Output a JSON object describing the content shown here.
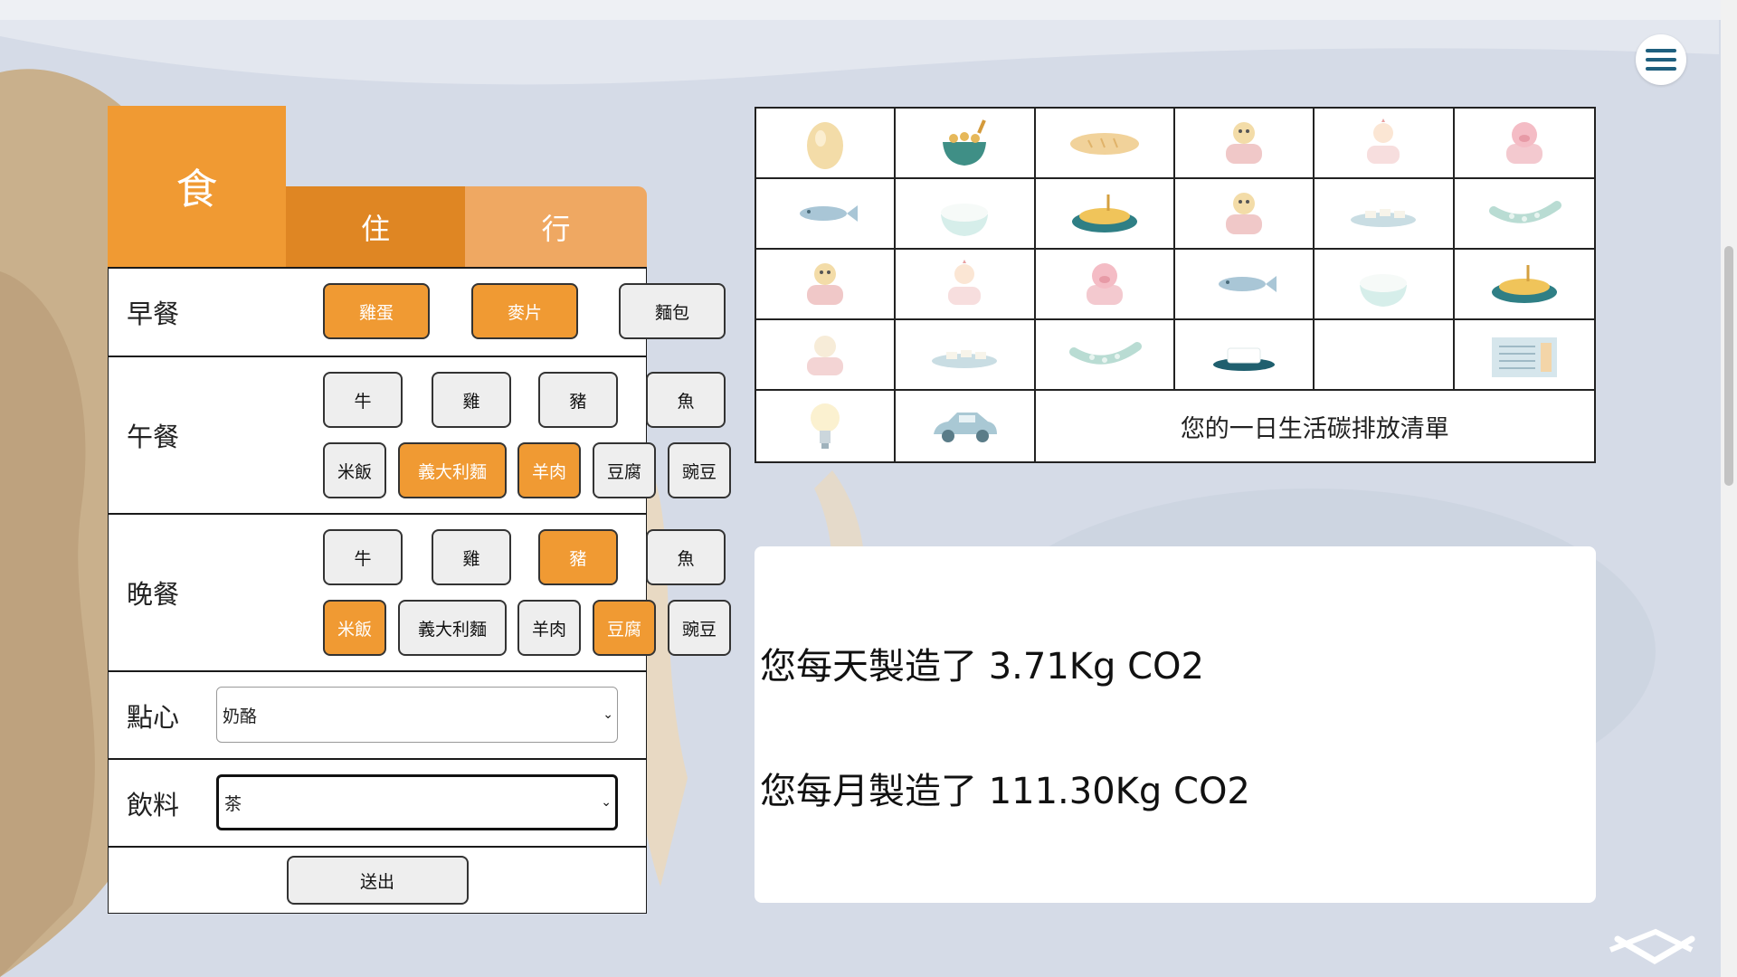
{
  "colors": {
    "accent": "#f09a33",
    "tab_home": "#df8623",
    "tab_transport": "#efa862",
    "button_idle": "#eeeeee",
    "background": "#d5dbe7"
  },
  "tabs": [
    {
      "label": "食",
      "active": true
    },
    {
      "label": "住",
      "active": false
    },
    {
      "label": "行",
      "active": false
    }
  ],
  "meals": {
    "breakfast": {
      "label": "早餐",
      "options": [
        {
          "label": "雞蛋",
          "selected": true
        },
        {
          "label": "麥片",
          "selected": true
        },
        {
          "label": "麵包",
          "selected": false
        }
      ]
    },
    "lunch": {
      "label": "午餐",
      "proteins": [
        {
          "label": "牛",
          "selected": false
        },
        {
          "label": "雞",
          "selected": false
        },
        {
          "label": "豬",
          "selected": false
        },
        {
          "label": "魚",
          "selected": false
        }
      ],
      "sides": [
        {
          "label": "米飯",
          "selected": false
        },
        {
          "label": "義大利麵",
          "selected": true
        },
        {
          "label": "羊肉",
          "selected": true
        },
        {
          "label": "豆腐",
          "selected": false
        },
        {
          "label": "豌豆",
          "selected": false
        }
      ]
    },
    "dinner": {
      "label": "晚餐",
      "proteins": [
        {
          "label": "牛",
          "selected": false
        },
        {
          "label": "雞",
          "selected": false
        },
        {
          "label": "豬",
          "selected": true
        },
        {
          "label": "魚",
          "selected": false
        }
      ],
      "sides": [
        {
          "label": "米飯",
          "selected": true
        },
        {
          "label": "義大利麵",
          "selected": false
        },
        {
          "label": "羊肉",
          "selected": false
        },
        {
          "label": "豆腐",
          "selected": true
        },
        {
          "label": "豌豆",
          "selected": false
        }
      ]
    },
    "snack": {
      "label": "點心",
      "value": "奶酪"
    },
    "drink": {
      "label": "飲料",
      "value": "茶"
    }
  },
  "submit_label": "送出",
  "icon_grid": {
    "icons": [
      "egg-icon",
      "cereal-bowl-icon",
      "bread-icon",
      "beef-icon",
      "chicken-icon",
      "pork-icon",
      "fish-icon",
      "rice-icon",
      "pasta-icon",
      "beef-icon",
      "tofu-icon",
      "peas-icon",
      "beef-icon",
      "chicken-icon",
      "pork-icon",
      "fish-icon",
      "rice-icon",
      "pasta-icon",
      "lamb-icon",
      "tofu-icon",
      "peas-icon",
      "cheese-icon",
      "",
      "air-conditioner-icon",
      "light-bulb-icon",
      "car-icon"
    ],
    "summary_title": "您的一日生活碳排放清單"
  },
  "result": {
    "daily": "您每天製造了 3.71Kg CO2",
    "monthly": "您每月製造了 111.30Kg CO2"
  }
}
